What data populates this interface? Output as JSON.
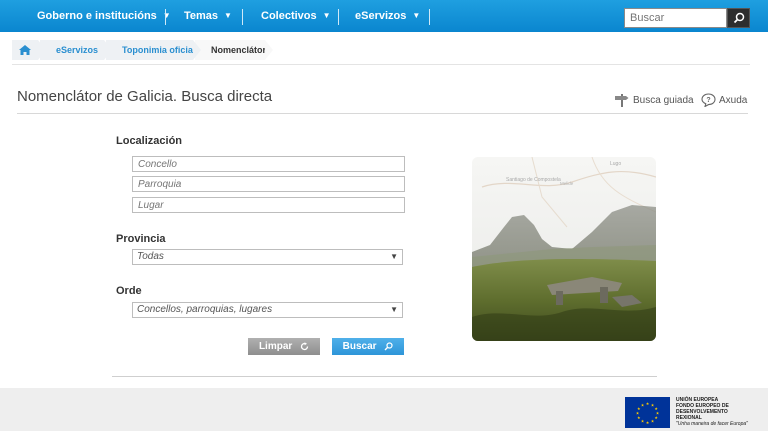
{
  "nav": {
    "items": [
      {
        "label": "Goberno e institucións"
      },
      {
        "label": "Temas"
      },
      {
        "label": "Colectivos"
      },
      {
        "label": "eServizos"
      }
    ],
    "search_placeholder": "Buscar"
  },
  "breadcrumb": [
    "eServizos",
    "Toponimia oficial",
    "Nomenclátor"
  ],
  "page": {
    "title": "Nomenclátor de Galicia. Busca directa",
    "guided_search": "Busca guiada",
    "help": "Axuda"
  },
  "form": {
    "location_label": "Localización",
    "concello_placeholder": "Concello",
    "parroquia_placeholder": "Parroquia",
    "lugar_placeholder": "Lugar",
    "province_label": "Provincia",
    "province_value": "Todas",
    "order_label": "Orde",
    "order_value": "Concellos, parroquias, lugares",
    "clear_button": "Limpar",
    "search_button": "Buscar"
  },
  "map_labels": [
    "Lugo",
    "Santiago de Compostela",
    "Melide"
  ],
  "footer": {
    "eu_lines": [
      "UNIÓN EUROPEA",
      "FONDO EUROPEO DE",
      "DESENVOLVEMENTO",
      "REXIONAL"
    ],
    "eu_motto": "\"Unha maneira de facer Europa\""
  },
  "colors": {
    "nav_bar": "#0a86cf",
    "link_blue": "#2a8fd0",
    "search_button": "#2d95d8",
    "clear_button": "#8e8e8e",
    "eu_blue": "#003399"
  }
}
